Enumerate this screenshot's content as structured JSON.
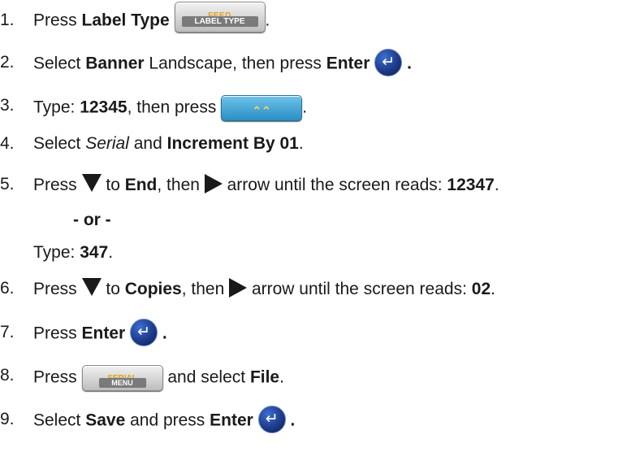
{
  "steps": [
    {
      "num": "1.",
      "pre": "Press ",
      "b1": "Label Type",
      "post": "."
    },
    {
      "num": "2.",
      "pre": "Select ",
      "b1": "Banner",
      "mid": " Landscape, then press ",
      "b2": "Enter",
      "end": "."
    },
    {
      "num": "3.",
      "pre": "Type: ",
      "b1": "12345",
      "mid": ", then press",
      "post": "."
    },
    {
      "num": "4.",
      "pre": "Select ",
      "i1": "Serial",
      "mid": " and ",
      "b1": "Increment By 01",
      "post": "."
    },
    {
      "num": "5.",
      "pre": "Press",
      "mid": " to ",
      "b1": "End",
      "mid2": ", then",
      "mid3": " arrow until the screen reads: ",
      "b2": "12347",
      "post": "."
    },
    {
      "num": "6.",
      "pre": "Press",
      "mid": " to ",
      "b1": "Copies",
      "mid2": ", then",
      "mid3": " arrow until the screen reads: ",
      "b2": "02",
      "post": "."
    },
    {
      "num": "7.",
      "pre": "Press ",
      "b1": "Enter",
      "end": "."
    },
    {
      "num": "8.",
      "pre": "Press",
      "mid": " and select ",
      "b1": "File",
      "post": "."
    },
    {
      "num": "9.",
      "pre": "Select ",
      "b1": "Save",
      "mid": " and press ",
      "b2": "Enter",
      "end": "."
    }
  ],
  "or_line": "- or -",
  "alt_type": {
    "pre": "Type: ",
    "b": "347",
    "post": "."
  },
  "keys": {
    "feed_top": "FEED",
    "feed_bottom": "LABEL TYPE",
    "serial_top": "SERIAL",
    "serial_bottom": "MENU",
    "enter_icon": "enter-arrow",
    "shift_icon": "double-up-chevron"
  },
  "colors": {
    "key_gold": "#e0a020",
    "enter_blue": "#1e3a8a",
    "shift_blue": "#2a8fc4"
  }
}
